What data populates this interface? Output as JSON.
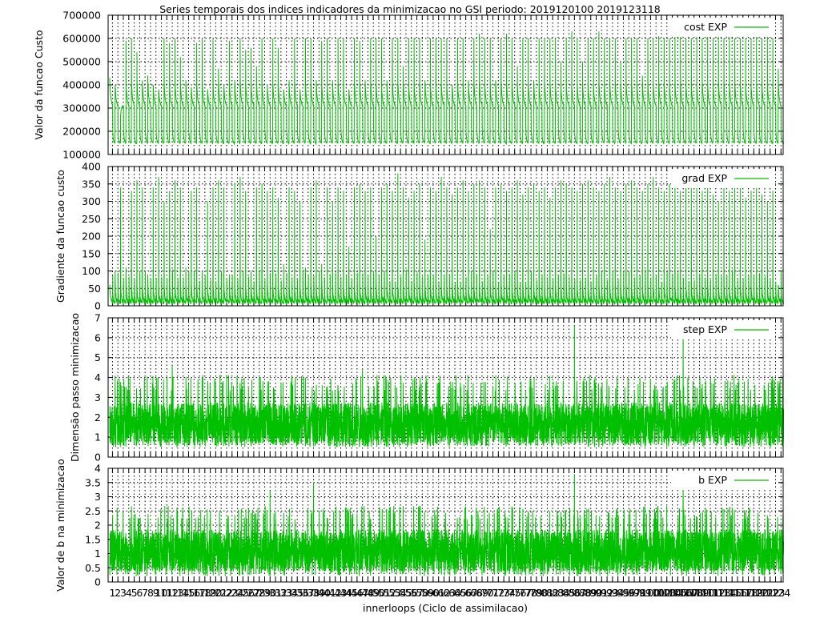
{
  "title": "Series temporais dos indices indicadores da minimizacao no GSI periodo: 2019120100 2019123118",
  "xlabel": "innerloops (Ciclo de assimilacao)",
  "color": "#00c000",
  "chart_data": [
    {
      "type": "line",
      "ylabel": "Valor da funcao Custo",
      "legend": "cost EXP",
      "legend_position": "top-right",
      "grid": true,
      "ylim": [
        100000,
        700000
      ],
      "yticks": [
        "100000",
        "200000",
        "300000",
        "400000",
        "500000",
        "600000",
        "700000"
      ],
      "cycle_peak": [
        430000,
        400000,
        270000,
        590000,
        600000,
        540000,
        420000,
        440000,
        400000,
        380000,
        600000,
        580000,
        600000,
        520000,
        420000,
        390000,
        580000,
        600000,
        380000,
        600000,
        470000,
        400000,
        590000,
        420000,
        600000,
        550000,
        560000,
        480000,
        600000,
        400000,
        600000,
        560000,
        380000,
        420000,
        600000,
        380000,
        600000,
        600000,
        420000,
        590000,
        600000,
        420000,
        600000,
        600000,
        380000,
        600000,
        590000,
        420000,
        600000,
        600000,
        600000,
        420000,
        600000,
        600000,
        480000,
        600000,
        600000,
        600000,
        420000,
        600000,
        600000,
        600000,
        600000,
        400000,
        600000,
        600000,
        420000,
        600000,
        620000,
        600000,
        600000,
        420000,
        600000,
        620000,
        600000,
        480000,
        600000,
        600000,
        420000,
        600000,
        600000,
        600000,
        600000,
        500000,
        600000,
        630000,
        600000,
        500000,
        600000,
        600000,
        630000,
        600000,
        600000,
        600000,
        500000,
        600000,
        600000,
        600000,
        440000,
        600000,
        600000,
        610000,
        600000,
        600000,
        610000,
        620000,
        600000,
        600000,
        610000,
        600000,
        620000,
        600000,
        610000,
        600000,
        620000,
        600000,
        600000,
        600000,
        600000,
        610000,
        600000,
        620000,
        600000,
        470000
      ],
      "outer1_end": 305000,
      "outer2_start": 195000,
      "outer2_end": 150000
    },
    {
      "type": "line",
      "ylabel": "Gradiente da funcao custo",
      "legend": "grad EXP",
      "legend_position": "top-right",
      "grid": true,
      "ylim": [
        0,
        400
      ],
      "yticks": [
        "0",
        "50",
        "100",
        "150",
        "200",
        "250",
        "300",
        "350",
        "400"
      ],
      "cycle_peak": [
        60,
        100,
        340,
        110,
        330,
        360,
        340,
        90,
        340,
        370,
        300,
        330,
        360,
        340,
        110,
        330,
        340,
        100,
        300,
        340,
        360,
        340,
        90,
        350,
        370,
        330,
        100,
        340,
        350,
        330,
        340,
        310,
        120,
        340,
        330,
        300,
        110,
        340,
        360,
        120,
        340,
        300,
        340,
        330,
        170,
        340,
        350,
        330,
        340,
        200,
        340,
        350,
        330,
        380,
        340,
        310,
        330,
        350,
        190,
        340,
        330,
        370,
        340,
        320,
        340,
        360,
        330,
        350,
        360,
        340,
        220,
        340,
        350,
        330,
        340,
        360,
        320,
        340,
        350,
        330,
        340,
        310,
        340,
        360,
        350,
        340,
        330,
        350,
        360,
        340,
        330,
        350,
        370,
        340,
        330,
        350,
        360,
        340,
        330,
        350,
        370,
        340,
        330,
        350,
        360,
        330,
        350,
        340,
        360,
        330,
        350,
        320,
        300,
        340,
        330,
        350,
        340,
        310,
        330,
        340,
        320,
        300,
        330,
        60
      ],
      "outer2_start": 95,
      "end": 5
    },
    {
      "type": "line",
      "ylabel": "Dimensão passo minimizacao",
      "legend": "step EXP",
      "legend_position": "top-right",
      "grid": true,
      "ylim": [
        0,
        7
      ],
      "yticks": [
        "0",
        "1",
        "2",
        "3",
        "4",
        "5",
        "6",
        "7"
      ],
      "mean": 1.7,
      "range": [
        0.5,
        3.3
      ],
      "spikes": [
        {
          "cycle": 86,
          "value": 6.6
        },
        {
          "cycle": 106,
          "value": 6.0
        },
        {
          "cycle": 47,
          "value": 4.4
        },
        {
          "cycle": 12,
          "value": 4.6
        }
      ]
    },
    {
      "type": "line",
      "ylabel": "Valor de b na minimizacao",
      "legend": "b EXP",
      "legend_position": "top-right",
      "grid": true,
      "ylim": [
        0,
        4
      ],
      "yticks": [
        "0",
        "0.5",
        "1",
        "1.5",
        "2",
        "2.5",
        "3",
        "3.5",
        "4"
      ],
      "mean": 1.1,
      "range": [
        0.2,
        2.2
      ],
      "spikes": [
        {
          "cycle": 86,
          "value": 3.8
        },
        {
          "cycle": 38,
          "value": 3.5
        },
        {
          "cycle": 106,
          "value": 3.3
        },
        {
          "cycle": 30,
          "value": 3.2
        }
      ]
    }
  ],
  "x_categories_count": 124
}
